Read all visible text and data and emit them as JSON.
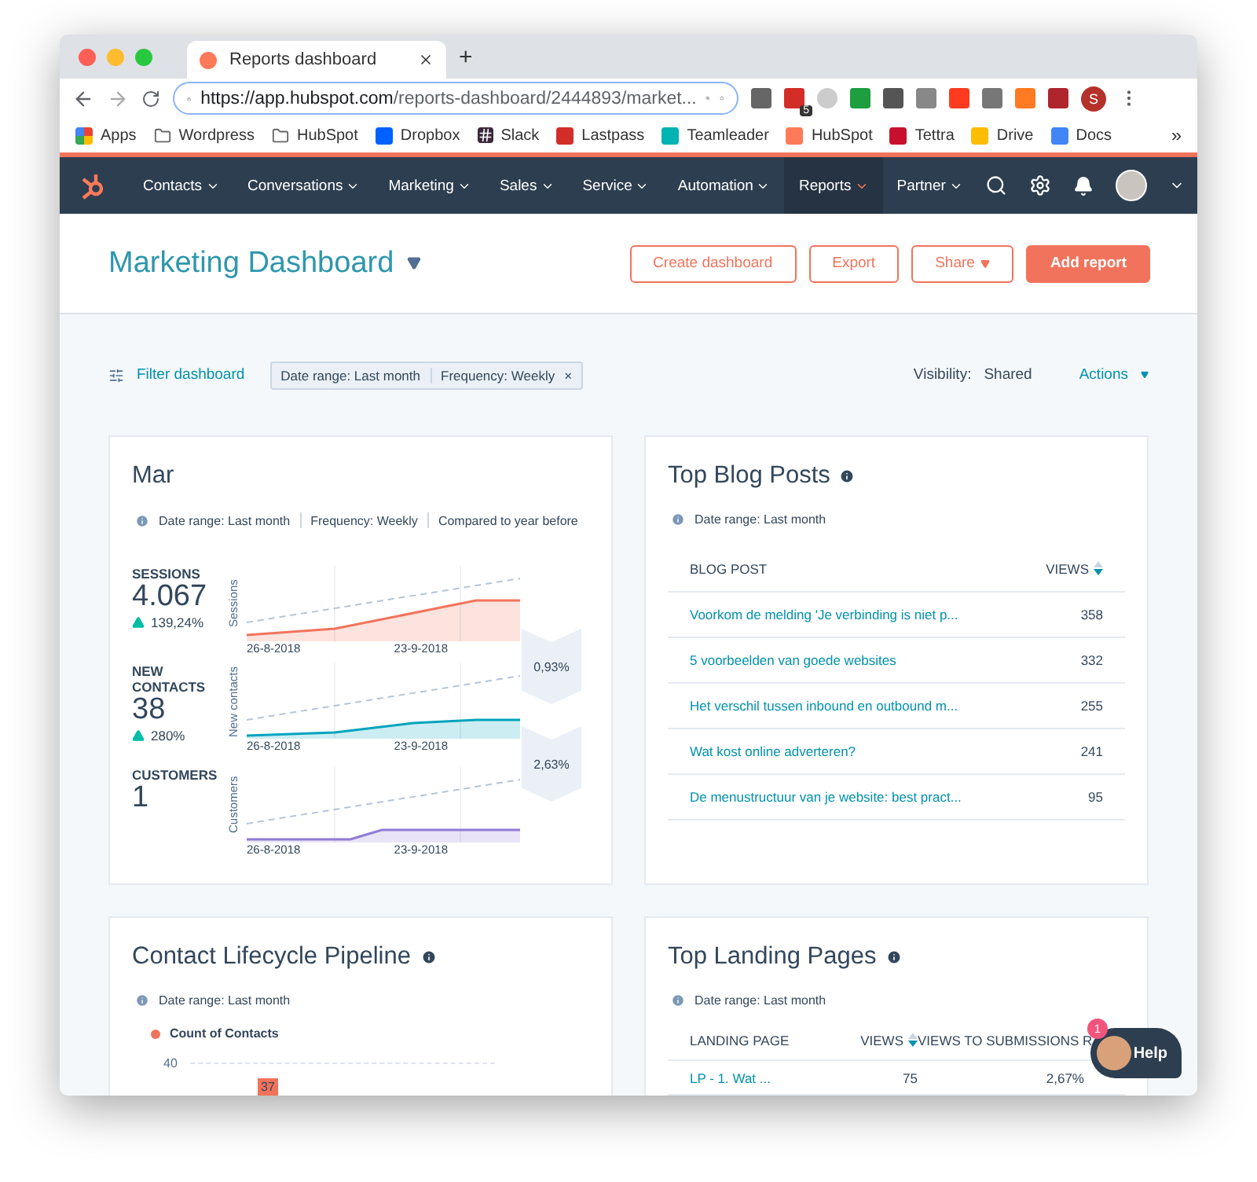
{
  "browser": {
    "tab_title": "Reports dashboard",
    "new_tab": "+",
    "url_host": "https://app.hubspot.com",
    "url_path": "/reports-dashboard/2444893/market...",
    "extension_badge": "5",
    "profile_initial": "S",
    "overflow": "»",
    "bookmarks": [
      {
        "label": "Apps",
        "kind": "apps"
      },
      {
        "label": "Wordpress",
        "kind": "folder"
      },
      {
        "label": "HubSpot",
        "kind": "folder"
      },
      {
        "label": "Dropbox",
        "kind": "dropbox"
      },
      {
        "label": "Slack",
        "kind": "slack"
      },
      {
        "label": "Lastpass",
        "kind": "lastpass"
      },
      {
        "label": "Teamleader",
        "kind": "teamleader"
      },
      {
        "label": "HubSpot",
        "kind": "hubspot"
      },
      {
        "label": "Tettra",
        "kind": "tettra"
      },
      {
        "label": "Drive",
        "kind": "drive"
      },
      {
        "label": "Docs",
        "kind": "docs"
      }
    ]
  },
  "nav": {
    "items": [
      {
        "label": "Contacts",
        "selected": false
      },
      {
        "label": "Conversations",
        "selected": false
      },
      {
        "label": "Marketing",
        "selected": false
      },
      {
        "label": "Sales",
        "selected": false
      },
      {
        "label": "Service",
        "selected": false
      },
      {
        "label": "Automation",
        "selected": false
      },
      {
        "label": "Reports",
        "selected": true
      },
      {
        "label": "Partner",
        "selected": false
      }
    ]
  },
  "header": {
    "title": "Marketing Dashboard",
    "buttons": [
      {
        "label": "Create dashboard",
        "kind": "outline"
      },
      {
        "label": "Export",
        "kind": "outline"
      },
      {
        "label": "Share",
        "kind": "dropdown"
      },
      {
        "label": "Add report",
        "kind": "primary"
      }
    ]
  },
  "filter_bar": {
    "filter_link": "Filter dashboard",
    "chips": [
      "Date range: Last month",
      "Frequency: Weekly"
    ],
    "clear": "×",
    "visibility_label": "Visibility:",
    "visibility_value": "Shared",
    "actions": "Actions"
  },
  "funnel_card": {
    "title": "Mar",
    "meta": [
      "Date range: Last month",
      "Frequency: Weekly",
      "Compared to year before"
    ],
    "metrics": [
      {
        "label": "SESSIONS",
        "value": "4.067",
        "change": "139,24%",
        "axis": "Sessions",
        "dates": [
          "26-8-2018",
          "23-9-2018"
        ],
        "color": "#f2735b"
      },
      {
        "label": "NEW CONTACTS",
        "value": "38",
        "change": "280%",
        "axis": "New contacts",
        "dates": [
          "26-8-2018",
          "23-9-2018"
        ],
        "color": "#00a4bd"
      },
      {
        "label": "CUSTOMERS",
        "value": "1",
        "axis": "Customers",
        "dates": [
          "26-8-2018",
          "23-9-2018"
        ],
        "color": "#8f7ad6"
      }
    ],
    "conversions": [
      "0,93%",
      "2,63%"
    ]
  },
  "blog_card": {
    "title": "Top Blog Posts",
    "meta": "Date range: Last month",
    "columns": [
      "BLOG POST",
      "VIEWS"
    ],
    "rows": [
      {
        "post": "Voorkom de melding 'Je verbinding is niet p...",
        "views": "358"
      },
      {
        "post": "5 voorbeelden van goede websites",
        "views": "332"
      },
      {
        "post": "Het verschil tussen inbound en outbound m...",
        "views": "255"
      },
      {
        "post": "Wat kost online adverteren?",
        "views": "241"
      },
      {
        "post": "De menustructuur van je website: best pract...",
        "views": "95"
      }
    ]
  },
  "pipeline_card": {
    "title": "Contact Lifecycle Pipeline",
    "meta": "Date range: Last month",
    "legend": "Count of Contacts",
    "y_tick": "40",
    "bar_label": "37"
  },
  "landing_card": {
    "title": "Top Landing Pages",
    "meta": "Date range: Last month",
    "columns": [
      "LANDING PAGE",
      "VIEWS",
      "VIEWS TO SUBMISSIONS R"
    ],
    "rows": [
      {
        "page": "LP - 1. Wat ...",
        "views": "75",
        "rate": "2,67%"
      }
    ]
  },
  "help": {
    "label": "Help",
    "badge": "1"
  }
}
